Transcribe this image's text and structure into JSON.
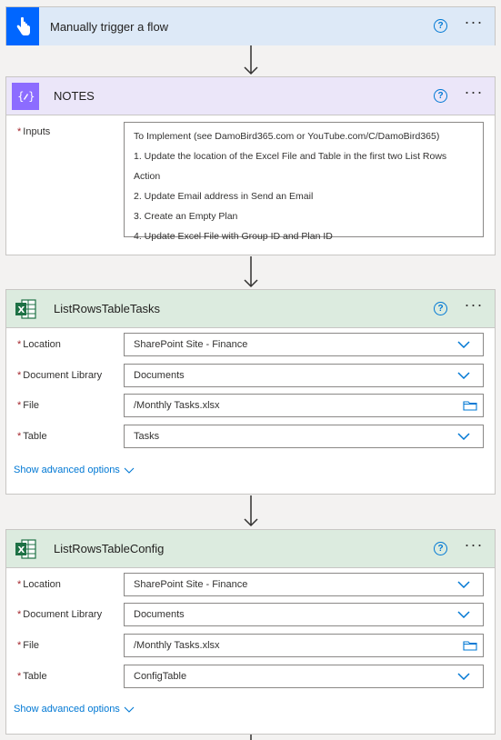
{
  "trigger": {
    "title": "Manually trigger a flow"
  },
  "notes": {
    "title": "NOTES",
    "inputs_label": "Inputs",
    "inputs_lines": [
      "To Implement (see DamoBird365.com or YouTube.com/C/DamoBird365)",
      "1. Update the location of the Excel File and Table in the first two List Rows",
      "Action",
      "2. Update Email address in Send an Email",
      "3. Create an Empty Plan",
      "4. Update Excel File with Group ID and Plan ID"
    ]
  },
  "tasks": {
    "title": "ListRowsTableTasks",
    "location_label": "Location",
    "location_value": "SharePoint Site - Finance",
    "doclib_label": "Document Library",
    "doclib_value": "Documents",
    "file_label": "File",
    "file_value": "/Monthly Tasks.xlsx",
    "table_label": "Table",
    "table_value": "Tasks",
    "advanced": "Show advanced options"
  },
  "config": {
    "title": "ListRowsTableConfig",
    "location_label": "Location",
    "location_value": "SharePoint Site - Finance",
    "doclib_label": "Document Library",
    "doclib_value": "Documents",
    "file_label": "File",
    "file_value": "/Monthly Tasks.xlsx",
    "table_label": "Table",
    "table_value": "ConfigTable",
    "advanced": "Show advanced options"
  },
  "icons": {
    "trigger": "hand-tap-icon",
    "notes": "compose-braces-icon",
    "excel": "excel-icon"
  },
  "colors": {
    "accent": "#0078d4",
    "trigger_header": "#dde9f7",
    "notes_header": "#ebe6f9",
    "excel_header": "#dcebdf",
    "required": "#a4262c"
  }
}
